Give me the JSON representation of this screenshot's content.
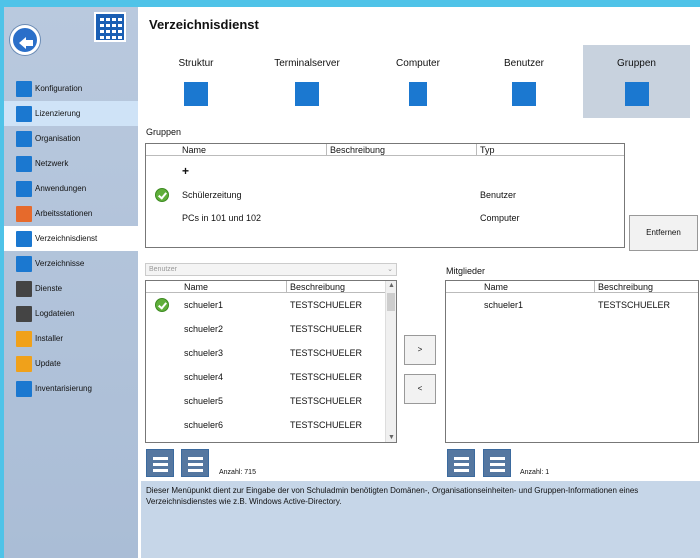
{
  "page": {
    "title": "Verzeichnisdienst"
  },
  "sidebar": {
    "items": [
      {
        "label": "Konfiguration",
        "icon": "gear-icon",
        "color": "#1b78d0"
      },
      {
        "label": "Lizenzierung",
        "icon": "license-icon",
        "color": "#1b78d0"
      },
      {
        "label": "Organisation",
        "icon": "building-icon",
        "color": "#1b78d0"
      },
      {
        "label": "Netzwerk",
        "icon": "network-icon",
        "color": "#1b78d0"
      },
      {
        "label": "Anwendungen",
        "icon": "window-icon",
        "color": "#1b78d0"
      },
      {
        "label": "Arbeitsstationen",
        "icon": "workstation-icon",
        "color": "#e66a2c"
      },
      {
        "label": "Verzeichnisdienst",
        "icon": "directory-icon",
        "color": "#1b78d0"
      },
      {
        "label": "Verzeichnisse",
        "icon": "folder-icon",
        "color": "#1b78d0"
      },
      {
        "label": "Dienste",
        "icon": "services-icon",
        "color": "#444444"
      },
      {
        "label": "Logdateien",
        "icon": "log-icon",
        "color": "#444444"
      },
      {
        "label": "Installer",
        "icon": "installer-icon",
        "color": "#f0a11a"
      },
      {
        "label": "Update",
        "icon": "update-icon",
        "color": "#f0a11a"
      },
      {
        "label": "Inventarisierung",
        "icon": "inventory-icon",
        "color": "#1b78d0"
      }
    ]
  },
  "tabs": [
    {
      "label": "Struktur",
      "icon": "structure-icon"
    },
    {
      "label": "Terminalserver",
      "icon": "terminalserver-icon"
    },
    {
      "label": "Computer",
      "icon": "computer-icon"
    },
    {
      "label": "Benutzer",
      "icon": "users-icon"
    },
    {
      "label": "Gruppen",
      "icon": "groups-icon"
    }
  ],
  "groups": {
    "label": "Gruppen",
    "columns": [
      "Name",
      "Beschreibung",
      "Typ"
    ],
    "add_symbol": "+",
    "rows": [
      {
        "name": "Schülerzeitung",
        "description": "",
        "type": "Benutzer",
        "checked": true
      },
      {
        "name": "PCs in 101 und 102",
        "description": "",
        "type": "Computer",
        "checked": false
      }
    ],
    "remove_button": "Entfernen"
  },
  "filter": {
    "selected": "Benutzer"
  },
  "users": {
    "columns": [
      "Name",
      "Beschreibung"
    ],
    "rows": [
      {
        "name": "schueler1",
        "description": "TESTSCHUELER",
        "checked": true
      },
      {
        "name": "schueler2",
        "description": "TESTSCHUELER",
        "checked": false
      },
      {
        "name": "schueler3",
        "description": "TESTSCHUELER",
        "checked": false
      },
      {
        "name": "schueler4",
        "description": "TESTSCHUELER",
        "checked": false
      },
      {
        "name": "schueler5",
        "description": "TESTSCHUELER",
        "checked": false
      },
      {
        "name": "schueler6",
        "description": "TESTSCHUELER",
        "checked": false
      }
    ],
    "count": "Anzahl: 715"
  },
  "transfer": {
    "add": ">",
    "remove": "<"
  },
  "members": {
    "label": "Mitglieder",
    "columns": [
      "Name",
      "Beschreibung"
    ],
    "rows": [
      {
        "name": "schueler1",
        "description": "TESTSCHUELER"
      }
    ],
    "count": "Anzahl: 1"
  },
  "footer": {
    "text": "Dieser Menüpunkt dient zur Eingabe der von Schuladmin benötigten Domänen-, Organisationseinheiten- und Gruppen-Informationen eines Verzeichnisdienstes wie z.B. Windows Active-Directory."
  }
}
